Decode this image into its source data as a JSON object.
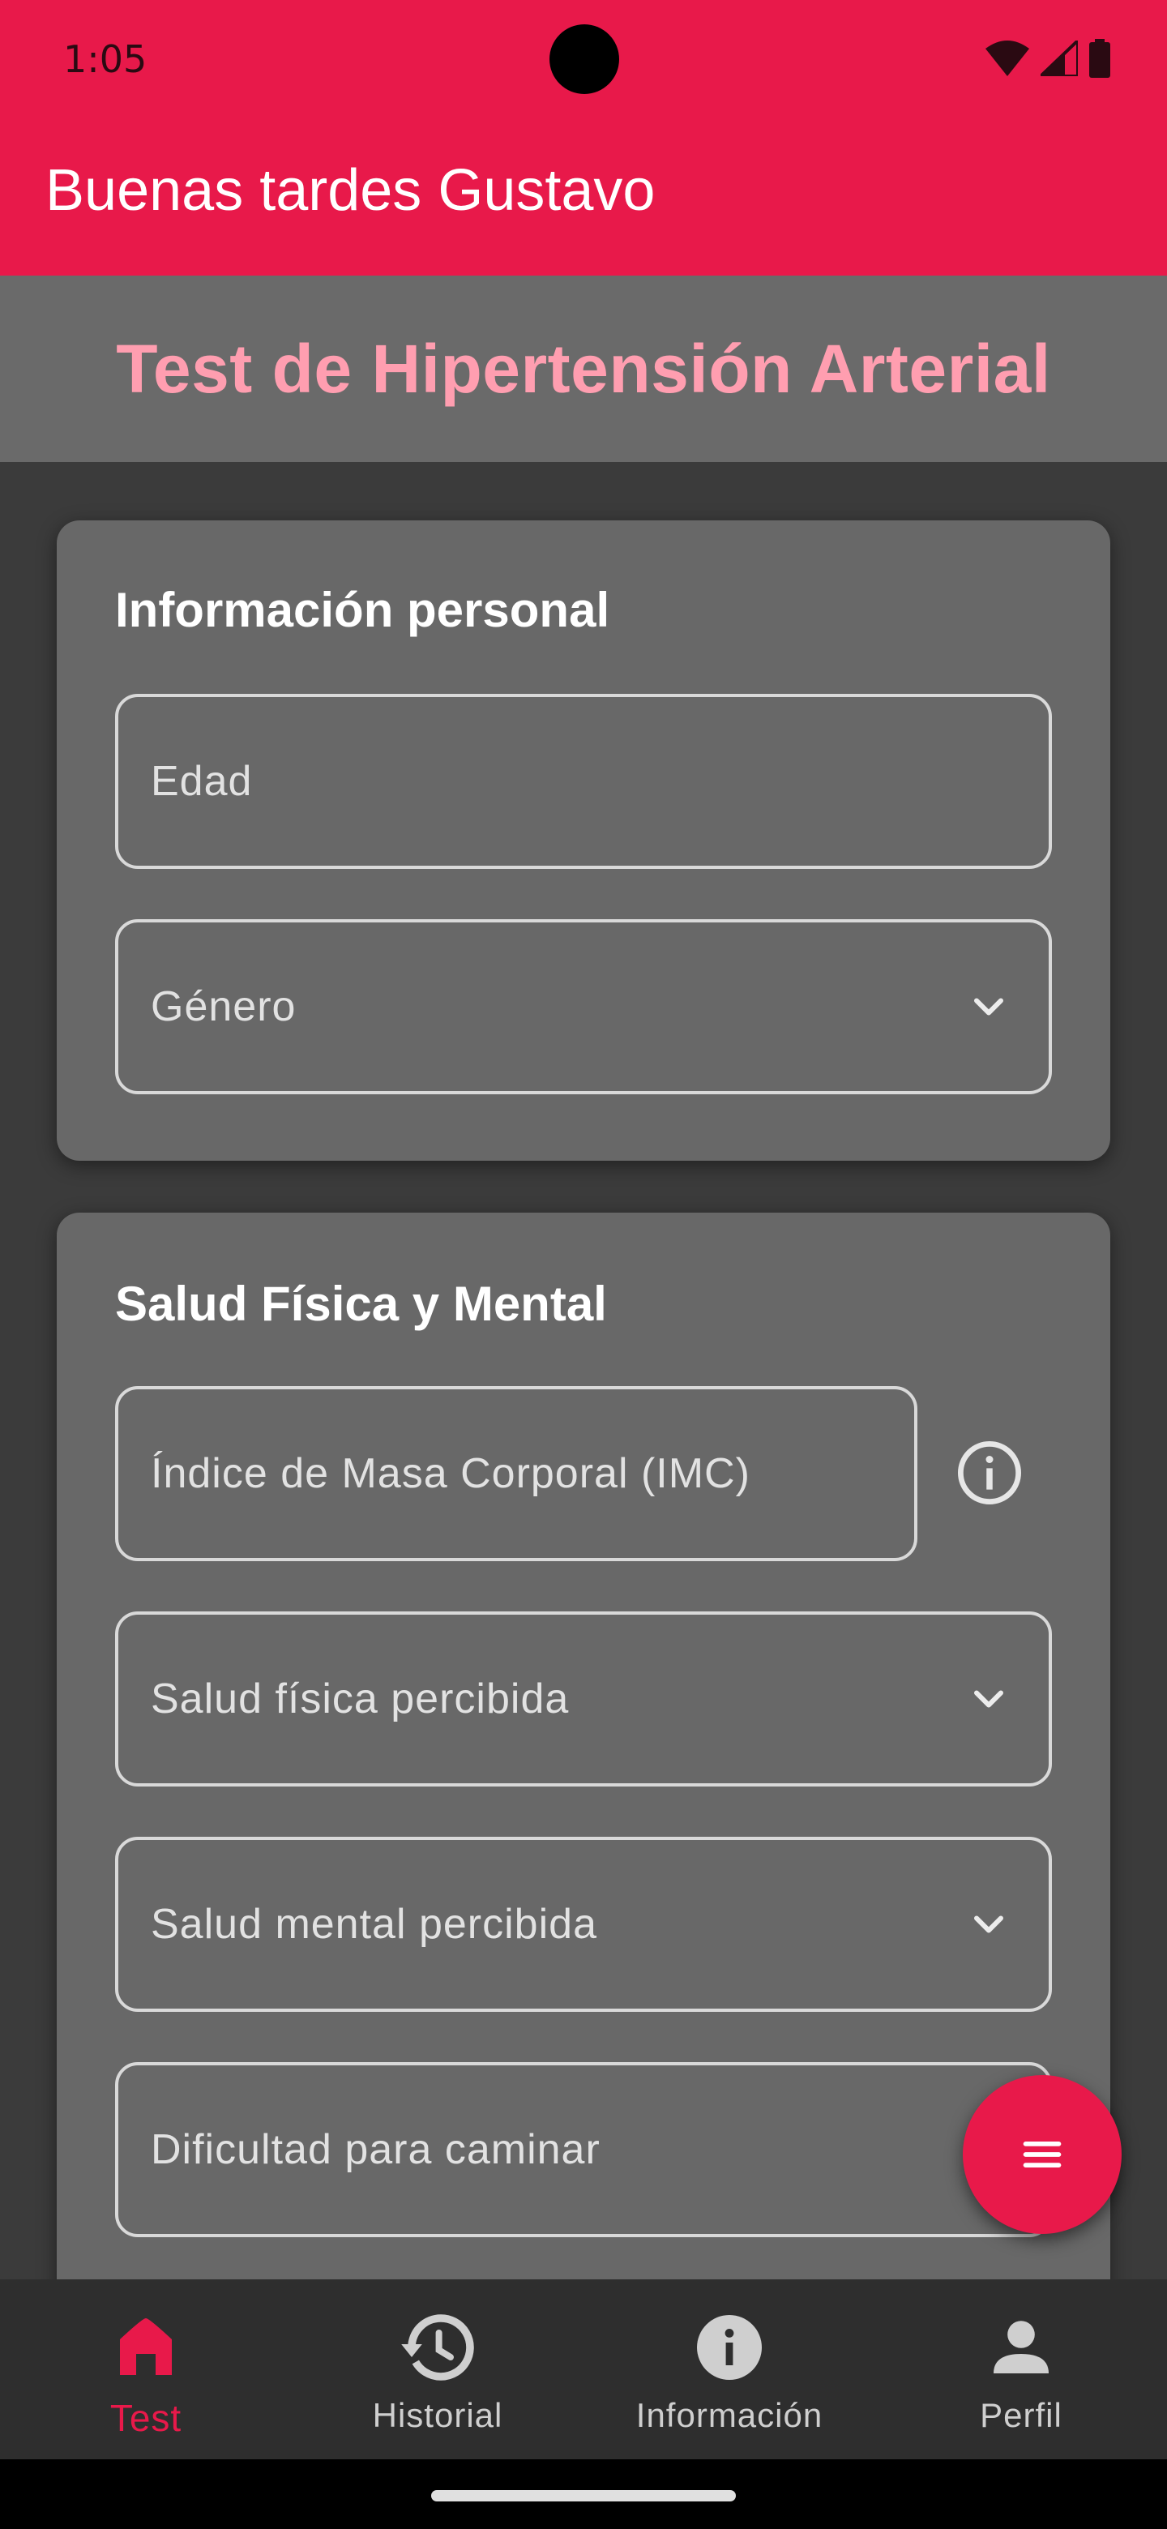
{
  "status_bar": {
    "time": "1:05",
    "icons": [
      "wifi-icon",
      "signal-icon",
      "battery-icon"
    ]
  },
  "app_bar": {
    "greeting": "Buenas tardes Gustavo"
  },
  "banner": {
    "title": "Test de Hipertensión Arterial"
  },
  "personal_card": {
    "title": "Información personal",
    "fields": {
      "age": {
        "label": "Edad",
        "type": "text"
      },
      "gender": {
        "label": "Género",
        "type": "dropdown"
      }
    }
  },
  "health_card": {
    "title": "Salud Física y Mental",
    "fields": {
      "bmi": {
        "label": "Índice de Masa Corporal (IMC)",
        "type": "text"
      },
      "physical": {
        "label": "Salud física percibida",
        "type": "dropdown"
      },
      "mental": {
        "label": "Salud mental percibida",
        "type": "dropdown"
      },
      "walking": {
        "label": "Dificultad para caminar",
        "type": "dropdown"
      }
    }
  },
  "fab": {
    "icon": "menu-icon"
  },
  "bottom_nav": {
    "items": [
      {
        "label": "Test",
        "icon": "home-icon",
        "active": true
      },
      {
        "label": "Historial",
        "icon": "history-icon",
        "active": false
      },
      {
        "label": "Información",
        "icon": "info-icon",
        "active": false
      },
      {
        "label": "Perfil",
        "icon": "person-icon",
        "active": false
      }
    ]
  },
  "colors": {
    "accent": "#e8194a",
    "banner_title": "#ff9eb0",
    "card": "#686868",
    "background": "#3b3b3b",
    "nav_bar": "#2e2e2e"
  }
}
